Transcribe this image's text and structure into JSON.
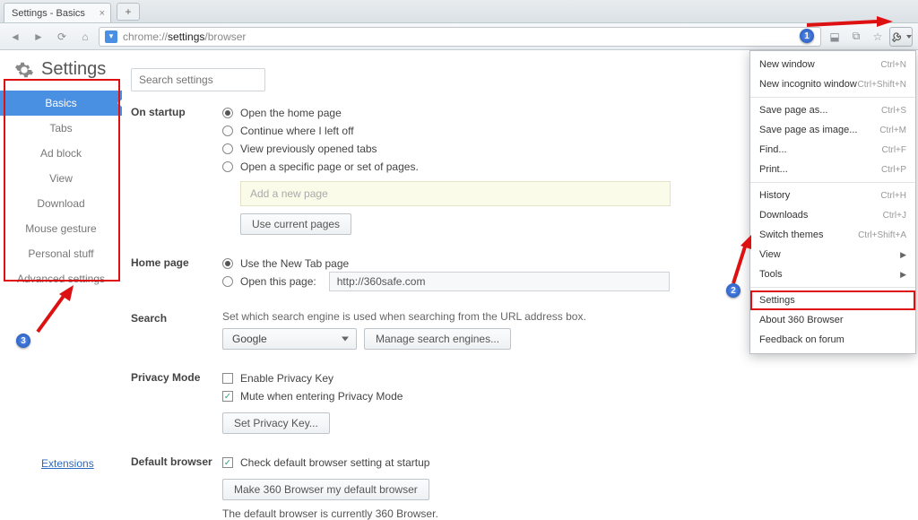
{
  "window": {
    "tab_title": "Settings - Basics"
  },
  "url": {
    "scheme": "chrome",
    "sep": "://",
    "host": "settings",
    "path": "/browser"
  },
  "header": {
    "title": "Settings",
    "search_placeholder": "Search settings"
  },
  "sidebar": {
    "items": [
      {
        "label": "Basics",
        "active": true
      },
      {
        "label": "Tabs"
      },
      {
        "label": "Ad block"
      },
      {
        "label": "View"
      },
      {
        "label": "Download"
      },
      {
        "label": "Mouse gesture"
      },
      {
        "label": "Personal stuff"
      },
      {
        "label": "Advanced settings"
      }
    ],
    "extensions_link": "Extensions"
  },
  "sections": {
    "startup": {
      "title": "On startup",
      "opt_home": "Open the home page",
      "opt_continue": "Continue where I left off",
      "opt_prev": "View previously opened tabs",
      "opt_specific": "Open a specific page or set of pages.",
      "add_new_page_ph": "Add a new page",
      "use_current_btn": "Use current pages"
    },
    "homepage": {
      "title": "Home page",
      "opt_newtab": "Use the New Tab page",
      "opt_open": "Open this page:",
      "url_value": "http://360safe.com"
    },
    "search": {
      "title": "Search",
      "desc": "Set which search engine is used when searching from the URL address box.",
      "engine": "Google",
      "manage_btn": "Manage search engines..."
    },
    "privacy": {
      "title": "Privacy Mode",
      "enable": "Enable Privacy Key",
      "mute": "Mute when entering Privacy Mode",
      "setkey_btn": "Set Privacy Key..."
    },
    "default": {
      "title": "Default browser",
      "check": "Check default browser setting at startup",
      "make_btn": "Make 360 Browser my default browser",
      "status": "The default browser is currently 360 Browser."
    }
  },
  "menu": {
    "items": [
      {
        "label": "New window",
        "shortcut": "Ctrl+N"
      },
      {
        "label": "New incognito window",
        "shortcut": "Ctrl+Shift+N"
      },
      {
        "sep": true
      },
      {
        "label": "Save page as...",
        "shortcut": "Ctrl+S"
      },
      {
        "label": "Save page as image...",
        "shortcut": "Ctrl+M"
      },
      {
        "label": "Find...",
        "shortcut": "Ctrl+F"
      },
      {
        "label": "Print...",
        "shortcut": "Ctrl+P"
      },
      {
        "sep": true
      },
      {
        "label": "History",
        "shortcut": "Ctrl+H"
      },
      {
        "label": "Downloads",
        "shortcut": "Ctrl+J"
      },
      {
        "label": "Switch themes",
        "shortcut": "Ctrl+Shift+A"
      },
      {
        "label": "View",
        "submenu": true
      },
      {
        "label": "Tools",
        "submenu": true
      },
      {
        "sep": true
      },
      {
        "label": "Settings",
        "highlight": true
      },
      {
        "label": "About 360 Browser"
      },
      {
        "label": "Feedback on forum"
      }
    ]
  },
  "annotations": {
    "n1": "1",
    "n2": "2",
    "n3": "3"
  }
}
